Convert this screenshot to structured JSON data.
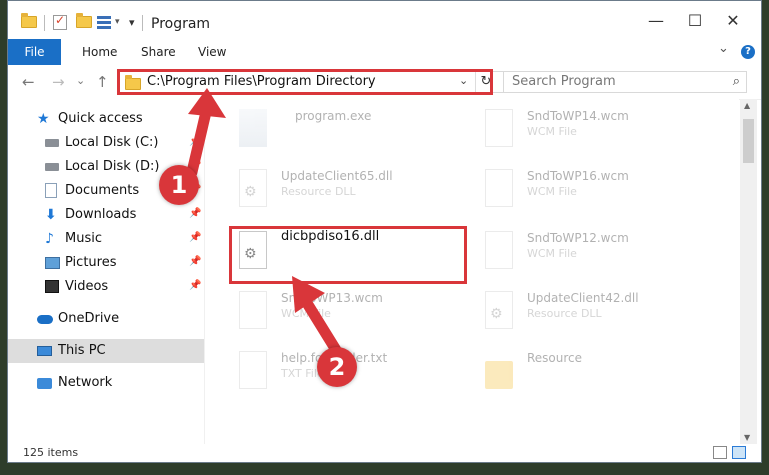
{
  "window": {
    "title": "Program",
    "min_glyph": "—",
    "max_glyph": "☐",
    "close_glyph": "✕"
  },
  "ribbon": {
    "file_tab": "File",
    "tabs": [
      "Home",
      "Share",
      "View"
    ],
    "collapse_glyph": "⌄",
    "help_glyph": "?"
  },
  "nav": {
    "back_glyph": "←",
    "forward_glyph": "→",
    "recent_glyph": "⌄",
    "up_glyph": "↑"
  },
  "address": {
    "path": "C:\\Program Files\\Program Directory",
    "dropdown_glyph": "⌄",
    "refresh_glyph": "↻"
  },
  "search": {
    "placeholder": "Search Program",
    "icon_glyph": "⌕"
  },
  "sidebar": {
    "items": [
      {
        "label": "Quick access",
        "icon": "star-icon",
        "pinned": false
      },
      {
        "label": "Local Disk (C:)",
        "icon": "disk-icon",
        "pinned": true
      },
      {
        "label": "Local Disk (D:)",
        "icon": "disk-icon",
        "pinned": true
      },
      {
        "label": "Documents",
        "icon": "documents-icon",
        "pinned": true
      },
      {
        "label": "Downloads",
        "icon": "downloads-icon",
        "pinned": true
      },
      {
        "label": "Music",
        "icon": "music-icon",
        "pinned": true
      },
      {
        "label": "Pictures",
        "icon": "pictures-icon",
        "pinned": true
      },
      {
        "label": "Videos",
        "icon": "videos-icon",
        "pinned": true
      },
      {
        "label": "OneDrive",
        "icon": "onedrive-icon",
        "pinned": false
      },
      {
        "label": "This PC",
        "icon": "this-pc-icon",
        "pinned": false,
        "selected": true
      },
      {
        "label": "Network",
        "icon": "network-icon",
        "pinned": false
      }
    ],
    "pin_glyph": "📌"
  },
  "files": [
    {
      "name": "program.exe",
      "type": "",
      "icon": "exe-icon"
    },
    {
      "name": "SndToWP14.wcm",
      "type": "WCM File",
      "icon": "file-icon"
    },
    {
      "name": "UpdateClient65.dll",
      "type": "Resource DLL",
      "icon": "dll-icon"
    },
    {
      "name": "SndToWP16.wcm",
      "type": "WCM File",
      "icon": "file-icon"
    },
    {
      "name": "dicbpdiso16.dll",
      "type": "",
      "icon": "dll-icon",
      "highlighted": true
    },
    {
      "name": "SndToWP12.wcm",
      "type": "WCM File",
      "icon": "file-icon"
    },
    {
      "name": "SndToWP13.wcm",
      "type": "WCM File",
      "icon": "file-icon"
    },
    {
      "name": "UpdateClient42.dll",
      "type": "Resource DLL",
      "icon": "dll-icon"
    },
    {
      "name": "help.for.loader.txt",
      "type": "TXT File",
      "icon": "file-icon"
    },
    {
      "name": "Resource",
      "type": "",
      "icon": "folder-icon"
    }
  ],
  "status": {
    "item_count": "125 items"
  },
  "annotations": {
    "step1": "1",
    "step2": "2",
    "color": "#d9363a"
  }
}
